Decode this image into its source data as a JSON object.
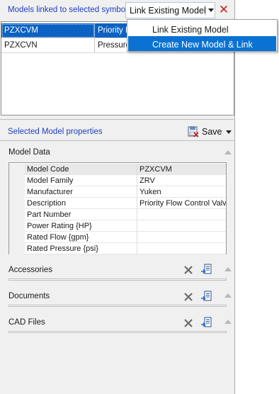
{
  "models_panel": {
    "title": "Models linked to selected symbol",
    "link_button_label": "Link Existing Model",
    "remove_icon": "close-icon",
    "rows": [
      {
        "code": "PZXCVM",
        "description": "Priority Flow Control Valve",
        "selected": true
      },
      {
        "code": "PZXCVN",
        "description": "Pressure Reducing Valve",
        "selected": false
      }
    ]
  },
  "link_dropdown": {
    "items": [
      {
        "label": "Link Existing Model",
        "highlighted": false
      },
      {
        "label": "Create New Model & Link",
        "highlighted": true
      }
    ]
  },
  "properties_panel": {
    "title": "Selected Model properties",
    "save_label": "Save",
    "model_data": {
      "title": "Model Data",
      "rows": [
        {
          "name": "Model Code",
          "value": "PZXCVM"
        },
        {
          "name": "Model Family",
          "value": "ZRV"
        },
        {
          "name": "Manufacturer",
          "value": "Yuken"
        },
        {
          "name": "Description",
          "value": "Priority Flow Control Valve"
        },
        {
          "name": "Part Number",
          "value": ""
        },
        {
          "name": "Power Rating {HP}",
          "value": ""
        },
        {
          "name": "Rated Flow {gpm}",
          "value": ""
        },
        {
          "name": "Rated Pressure {psi}",
          "value": ""
        }
      ]
    },
    "sections": [
      {
        "title": "Accessories"
      },
      {
        "title": "Documents"
      },
      {
        "title": "CAD Files"
      }
    ]
  },
  "colors": {
    "accent_text": "#1f3fbf",
    "selection": "#0b62c3",
    "menu_highlight": "#0b72d3",
    "remove_red": "#d21d1d"
  }
}
